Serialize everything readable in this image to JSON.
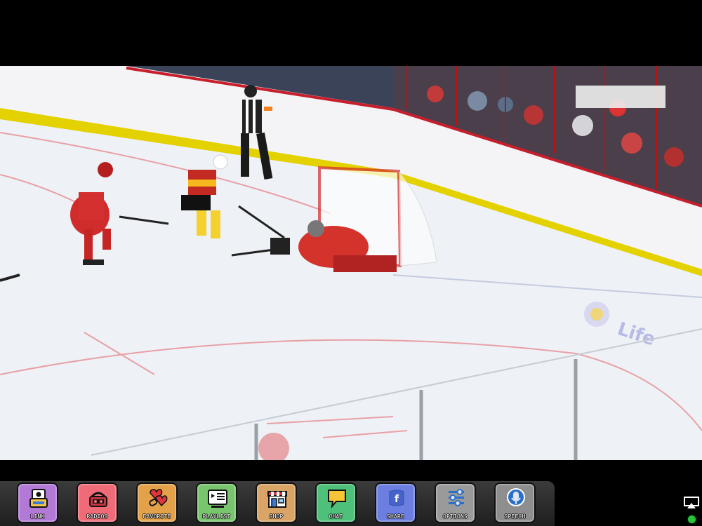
{
  "video": {
    "description_icon": "hockey-video-frame"
  },
  "dock": {
    "buttons": [
      {
        "label": "LINK",
        "icon": "link-icon",
        "color": "#b27ad6"
      },
      {
        "label": "RADIOS",
        "icon": "radio-icon",
        "color": "#ef6b78"
      },
      {
        "label": "FAVORITE",
        "icon": "favorite-icon",
        "color": "#e3a24a"
      },
      {
        "label": "PLAYLIST",
        "icon": "playlist-icon",
        "color": "#79c56e"
      },
      {
        "label": "SHOP",
        "icon": "shop-icon",
        "color": "#d9a466"
      },
      {
        "label": "CHAT",
        "icon": "chat-icon",
        "color": "#4ec07a"
      },
      {
        "label": "SHARE",
        "icon": "share-icon",
        "color": "#6c7fe0"
      },
      {
        "label": "OPTIONS",
        "icon": "options-icon",
        "color": "#9a9a9a"
      },
      {
        "label": "SPEECH",
        "icon": "speech-icon",
        "color": "#8e8e8e"
      }
    ]
  },
  "status": {
    "airplay_icon": "airplay-icon",
    "indicator_color": "#28c43a"
  }
}
